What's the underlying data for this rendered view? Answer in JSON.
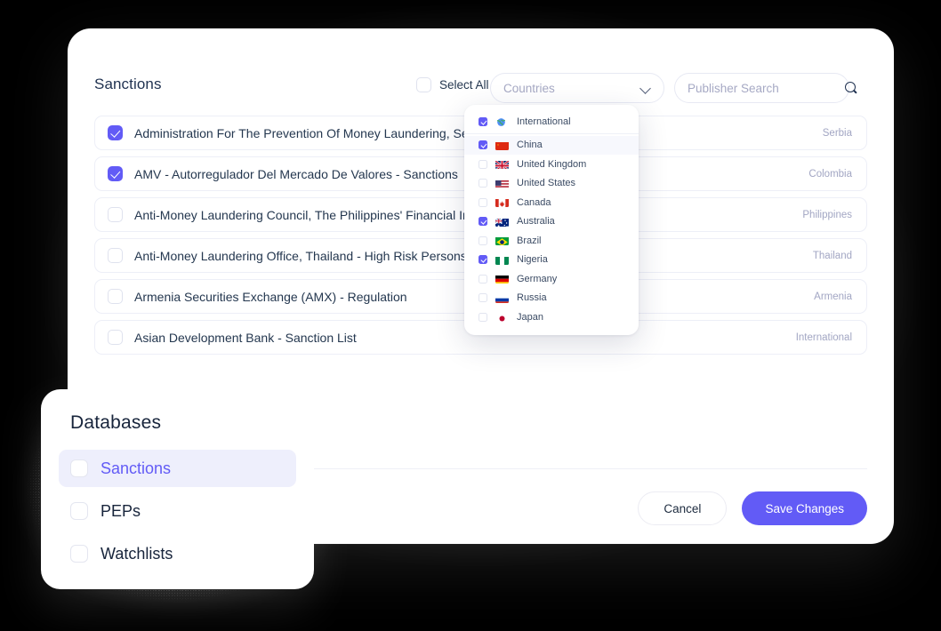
{
  "header": {
    "title": "Sanctions",
    "select_all_label": "Select All",
    "countries_select": {
      "value": "Countries",
      "icon": "chevron-down-icon"
    },
    "publisher_search": {
      "value": "",
      "placeholder": "Publisher Search",
      "icon": "search-icon"
    }
  },
  "publisher_rows": [
    {
      "name": "Administration For The Prevention Of Money Laundering, Serbia",
      "country": "Serbia",
      "checked": true
    },
    {
      "name": "AMV - Autorregulador Del Mercado De Valores - Sanctions",
      "country": "Colombia",
      "checked": true
    },
    {
      "name": "Anti-Money Laundering Council, The Philippines' Financial Intelligence Unit",
      "country": "Philippines",
      "checked": false
    },
    {
      "name": "Anti-Money Laundering Office, Thailand - High Risk Persons List",
      "country": "Thailand",
      "checked": false
    },
    {
      "name": "Armenia Securities Exchange (AMX) - Regulation",
      "country": "Armenia",
      "checked": false
    },
    {
      "name": "Asian Development Bank - Sanction List",
      "country": "International",
      "checked": false
    }
  ],
  "countries_dropdown": {
    "items": [
      {
        "label": "International",
        "flag": "globe-icon",
        "checked": true,
        "hovered": false,
        "separator_below": true
      },
      {
        "label": "China",
        "flag": "flag-china-icon",
        "checked": true,
        "hovered": true,
        "separator_below": false
      },
      {
        "label": "United Kingdom",
        "flag": "flag-uk-icon",
        "checked": false,
        "hovered": false,
        "separator_below": false
      },
      {
        "label": "United States",
        "flag": "flag-us-icon",
        "checked": false,
        "hovered": false,
        "separator_below": false
      },
      {
        "label": "Canada",
        "flag": "flag-canada-icon",
        "checked": false,
        "hovered": false,
        "separator_below": false
      },
      {
        "label": "Australia",
        "flag": "flag-australia-icon",
        "checked": true,
        "hovered": false,
        "separator_below": false
      },
      {
        "label": "Brazil",
        "flag": "flag-brazil-icon",
        "checked": false,
        "hovered": false,
        "separator_below": false
      },
      {
        "label": "Nigeria",
        "flag": "flag-nigeria-icon",
        "checked": true,
        "hovered": false,
        "separator_below": false
      },
      {
        "label": "Germany",
        "flag": "flag-germany-icon",
        "checked": false,
        "hovered": false,
        "separator_below": false
      },
      {
        "label": "Russia",
        "flag": "flag-russia-icon",
        "checked": false,
        "hovered": false,
        "separator_below": false
      },
      {
        "label": "Japan",
        "flag": "flag-japan-icon",
        "checked": false,
        "hovered": false,
        "separator_below": false
      }
    ]
  },
  "footer": {
    "cancel_label": "Cancel",
    "save_label": "Save Changes"
  },
  "databases_panel": {
    "title": "Databases",
    "items": [
      {
        "label": "Sanctions",
        "checked": false,
        "active": true
      },
      {
        "label": "PEPs",
        "checked": false,
        "active": false
      },
      {
        "label": "Watchlists",
        "checked": false,
        "active": false
      }
    ]
  },
  "colors": {
    "accent": "#625bf6",
    "title": "#1f3150",
    "muted": "#a2a6c3",
    "row_border": "#edeff7",
    "active_row_bg": "#eeeffc",
    "background": "#000000"
  }
}
